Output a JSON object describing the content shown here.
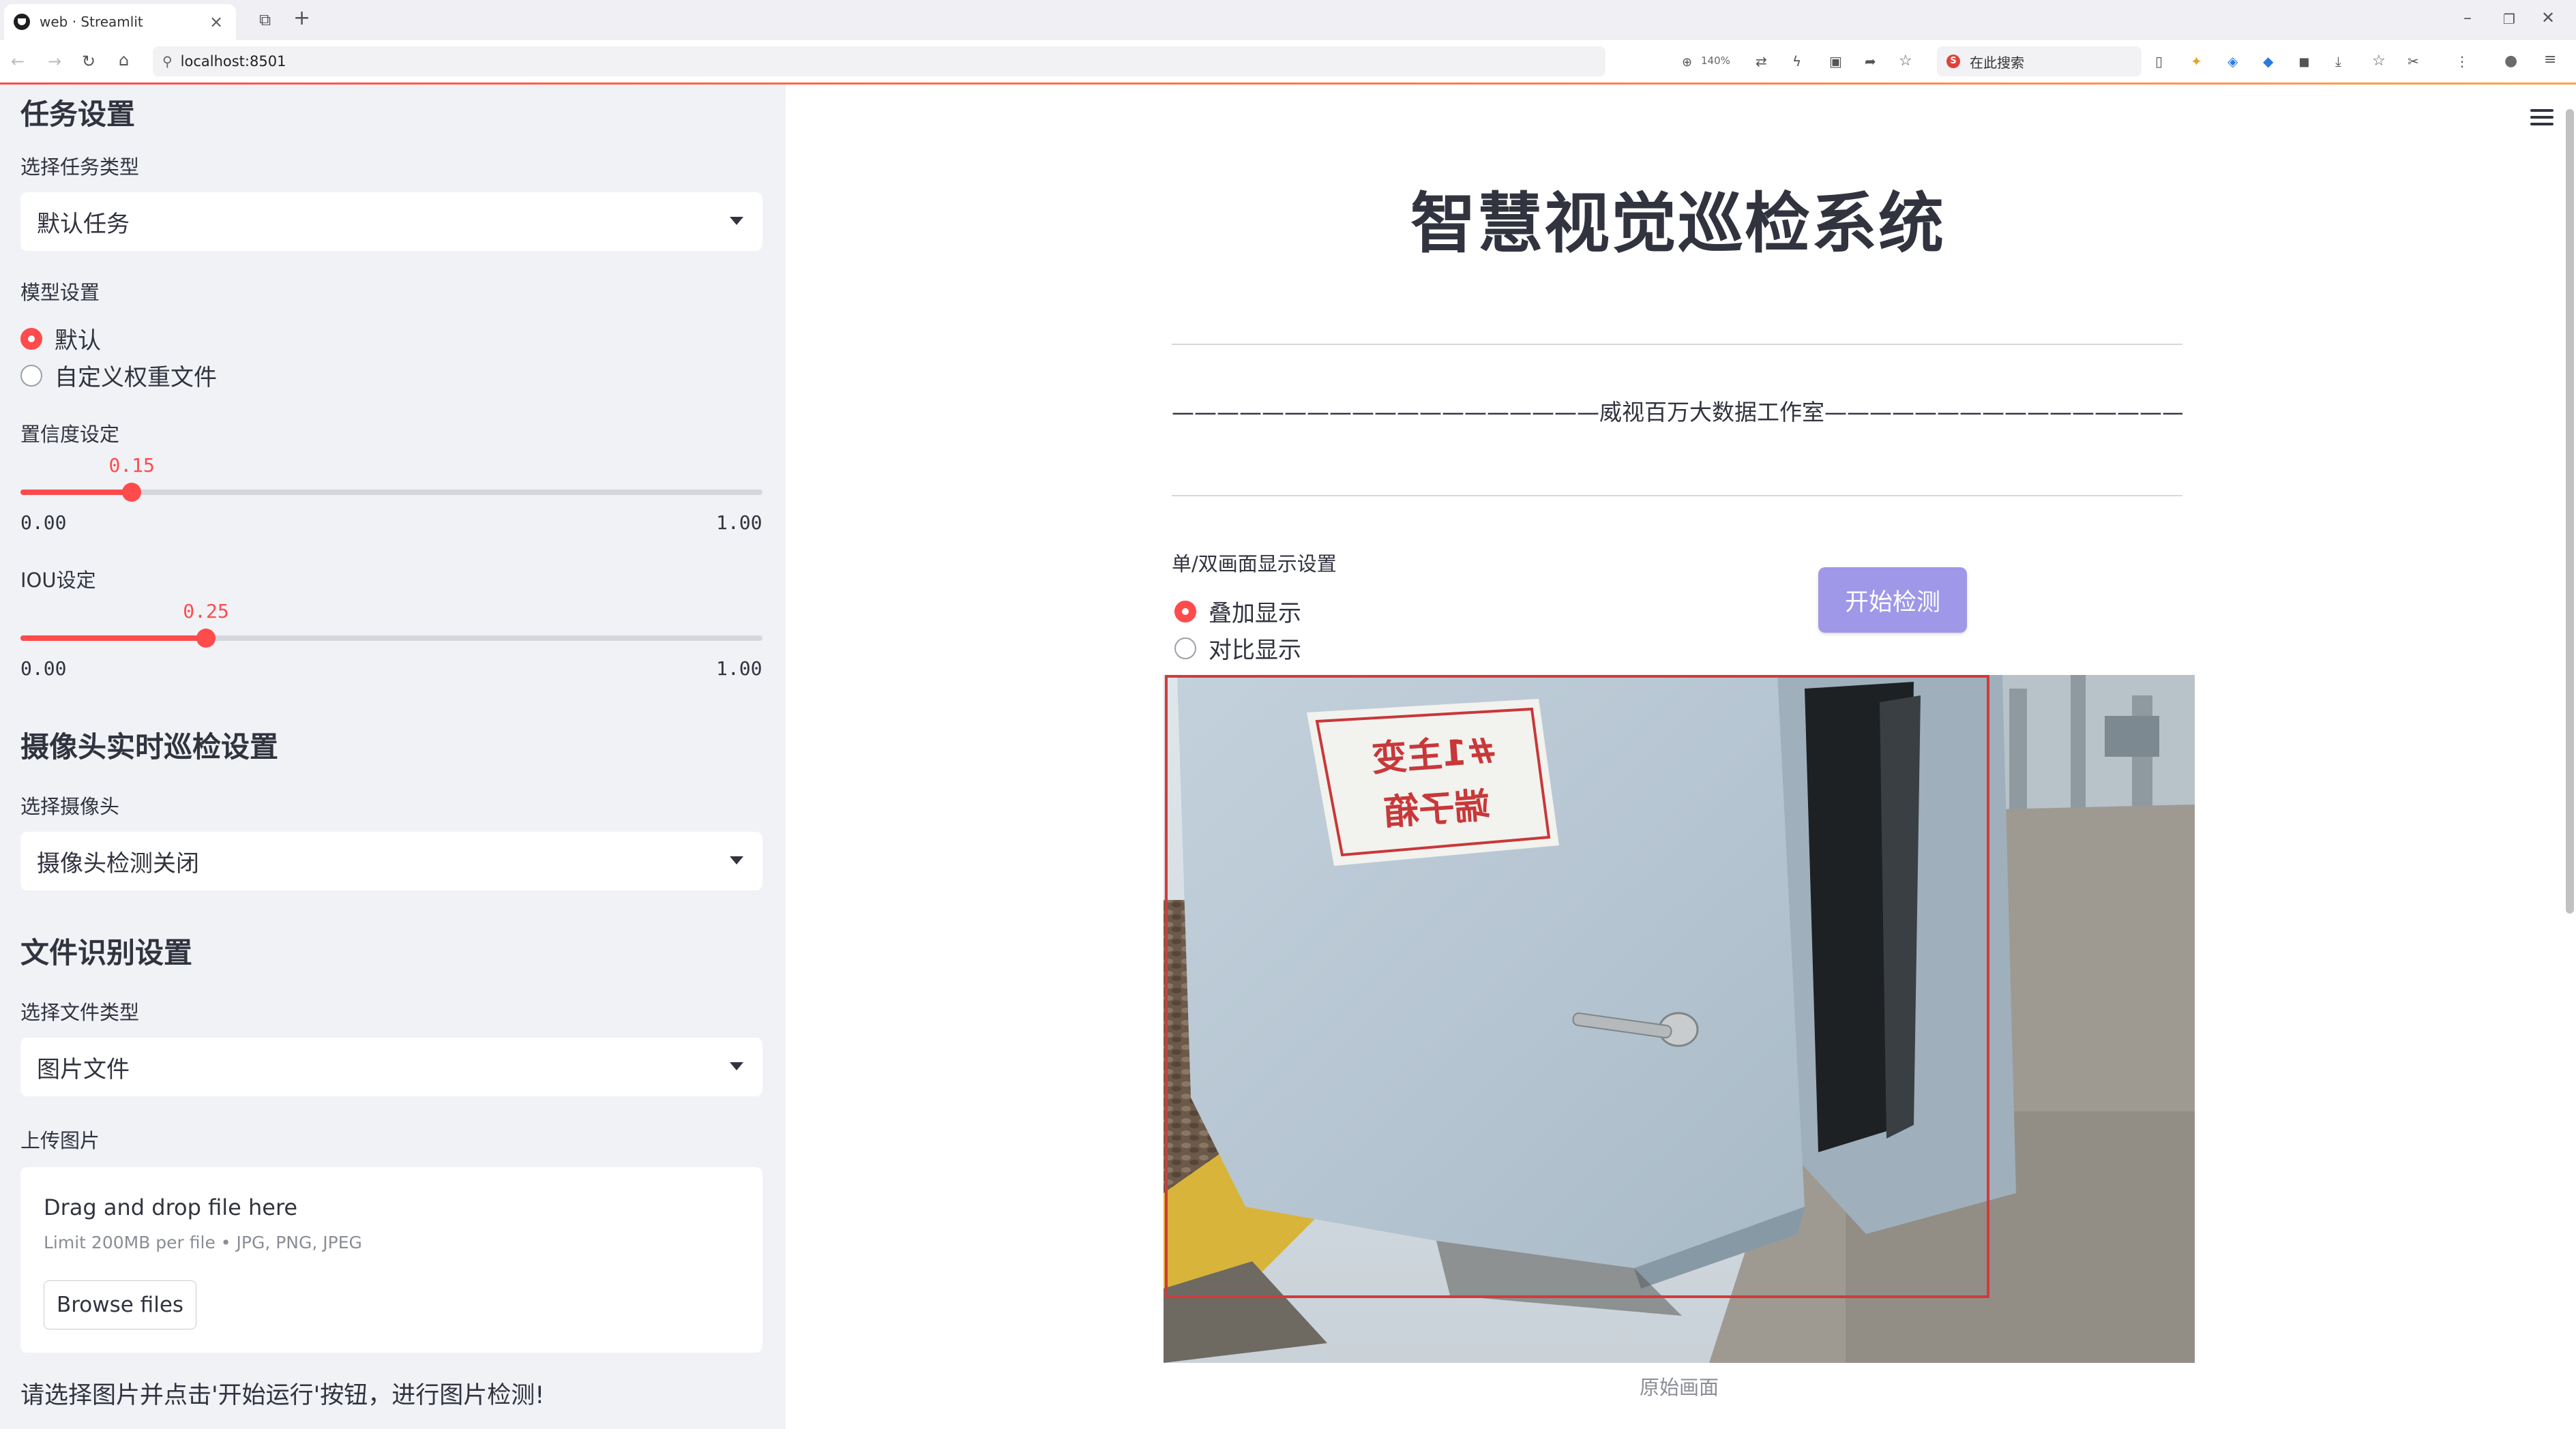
{
  "browser": {
    "tab_title": "web · Streamlit",
    "url": "localhost:8501",
    "zoom": "140%",
    "search_placeholder": "在此搜索",
    "icons": [
      "back-icon",
      "forward-icon",
      "reload-icon",
      "home-icon",
      "zoom-icon",
      "extensions-icon",
      "bookmark-star-icon",
      "menu-dots-icon"
    ]
  },
  "sidebar": {
    "task_section_title": "任务设置",
    "task_type_label": "选择任务类型",
    "task_type_value": "默认任务",
    "model_label": "模型设置",
    "model_options": [
      "默认",
      "自定义权重文件"
    ],
    "model_selected": "默认",
    "confidence_label": "置信度设定",
    "confidence": {
      "value": 0.15,
      "display": "0.15",
      "min": "0.00",
      "max": "1.00"
    },
    "iou_label": "IOU设定",
    "iou": {
      "value": 0.25,
      "display": "0.25",
      "min": "0.00",
      "max": "1.00"
    },
    "camera_section_title": "摄像头实时巡检设置",
    "camera_label": "选择摄像头",
    "camera_value": "摄像头检测关闭",
    "file_section_title": "文件识别设置",
    "file_type_label": "选择文件类型",
    "file_type_value": "图片文件",
    "upload_label": "上传图片",
    "upload_drop_text": "Drag and drop file here",
    "upload_limit_text": "Limit 200MB per file • JPG, PNG, JPEG",
    "browse_button": "Browse files",
    "hint_text": "请选择图片并点击'开始运行'按钮，进行图片检测!"
  },
  "main": {
    "title": "智慧视觉巡检系统",
    "studio_line": "———————————————————威视百万大数据工作室———————————————————",
    "display_label": "单/双画面显示设置",
    "display_options": [
      "叠加显示",
      "对比显示"
    ],
    "display_selected": "叠加显示",
    "start_button": "开始检测",
    "image_sign_text": [
      "#1主变",
      "端子箱"
    ],
    "image_caption": "原始画面",
    "accent_color": "#ff4b4b",
    "button_color": "#9f98e8"
  }
}
